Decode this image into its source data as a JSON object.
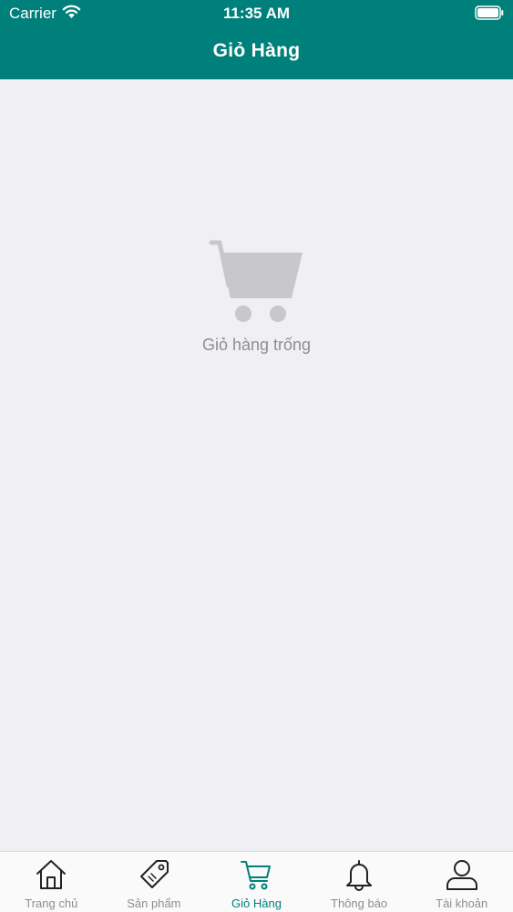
{
  "status_bar": {
    "carrier": "Carrier",
    "time": "11:35 AM"
  },
  "header": {
    "title": "Giỏ Hàng"
  },
  "empty_state": {
    "icon": "cart-icon",
    "message": "Giỏ hàng trống"
  },
  "tabs": [
    {
      "label": "Trang chủ",
      "icon": "home-icon",
      "active": false
    },
    {
      "label": "Sản phẩm",
      "icon": "tag-icon",
      "active": false
    },
    {
      "label": "Giỏ Hàng",
      "icon": "cart-icon",
      "active": true
    },
    {
      "label": "Thông báo",
      "icon": "bell-icon",
      "active": false
    },
    {
      "label": "Tài khoản",
      "icon": "user-icon",
      "active": false
    }
  ],
  "colors": {
    "brand": "#00807a",
    "background": "#efeff4",
    "muted": "#8e8e93",
    "icon": "#222222"
  }
}
